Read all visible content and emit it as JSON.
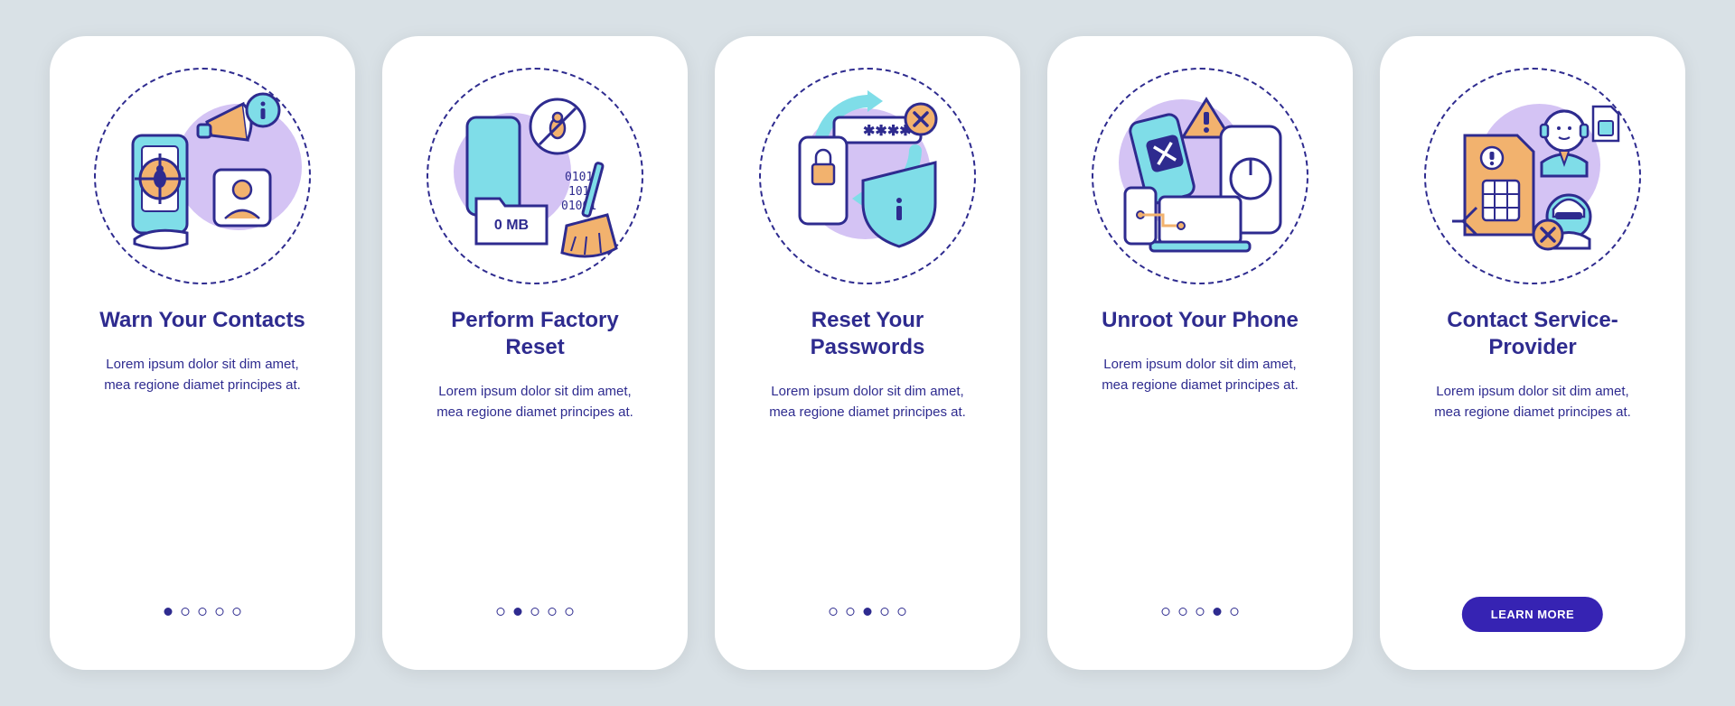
{
  "cards": [
    {
      "title": "Warn Your Contacts",
      "body": "Lorem ipsum dolor sit dim amet, mea regione diamet principes at.",
      "activeDot": 0,
      "showDots": true
    },
    {
      "title": "Perform Factory Reset",
      "body": "Lorem ipsum dolor sit dim amet, mea regione diamet principes at.",
      "activeDot": 1,
      "showDots": true,
      "badgeText": "0 MB"
    },
    {
      "title": "Reset Your Passwords",
      "body": "Lorem ipsum dolor sit dim amet, mea regione diamet principes at.",
      "activeDot": 2,
      "showDots": true
    },
    {
      "title": "Unroot Your Phone",
      "body": "Lorem ipsum dolor sit dim amet, mea regione diamet principes at.",
      "activeDot": 3,
      "showDots": true
    },
    {
      "title": "Contact Service-Provider",
      "body": "Lorem ipsum dolor sit dim amet, mea regione diamet principes at.",
      "activeDot": 4,
      "showDots": false,
      "ctaLabel": "LEARN MORE"
    }
  ],
  "colors": {
    "navy": "#2e2b8f",
    "cyan": "#7fdde8",
    "peach": "#f2b26e",
    "lilac": "#cdb9f2",
    "purpleBtn": "#3623b3"
  }
}
